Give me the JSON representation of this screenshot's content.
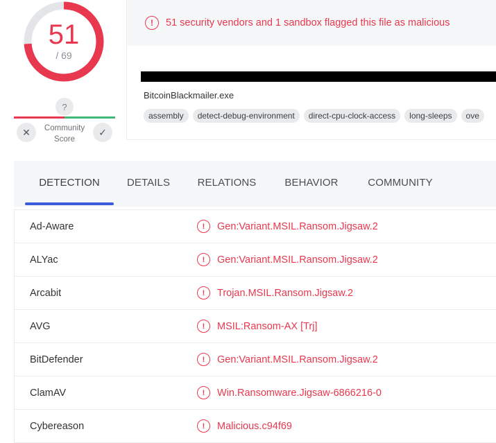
{
  "score": {
    "detected": "51",
    "total": "/ 69",
    "detected_value": 51,
    "total_value": 69,
    "ring_color": "#e8384f"
  },
  "community": {
    "question_mark": "?",
    "label_line1": "Community",
    "label_line2": "Score",
    "down_glyph": "✕",
    "up_glyph": "✓"
  },
  "alert": {
    "icon_glyph": "!",
    "text": "51 security vendors and 1 sandbox flagged this file as malicious"
  },
  "file": {
    "name": "BitcoinBlackmailer.exe",
    "tags": [
      "assembly",
      "detect-debug-environment",
      "direct-cpu-clock-access",
      "long-sleeps",
      "ove"
    ]
  },
  "tabs": [
    {
      "label": "DETECTION"
    },
    {
      "label": "DETAILS"
    },
    {
      "label": "RELATIONS"
    },
    {
      "label": "BEHAVIOR"
    },
    {
      "label": "COMMUNITY"
    }
  ],
  "detections": [
    {
      "engine": "Ad-Aware",
      "result": "Gen:Variant.MSIL.Ransom.Jigsaw.2"
    },
    {
      "engine": "ALYac",
      "result": "Gen:Variant.MSIL.Ransom.Jigsaw.2"
    },
    {
      "engine": "Arcabit",
      "result": "Trojan.MSIL.Ransom.Jigsaw.2"
    },
    {
      "engine": "AVG",
      "result": "MSIL:Ransom-AX [Trj]"
    },
    {
      "engine": "BitDefender",
      "result": "Gen:Variant.MSIL.Ransom.Jigsaw.2"
    },
    {
      "engine": "ClamAV",
      "result": "Win.Ransomware.Jigsaw-6866216-0"
    },
    {
      "engine": "Cybereason",
      "result": "Malicious.c94f69"
    }
  ],
  "colors": {
    "malicious": "#e8384f",
    "accent": "#3b5bdb",
    "community_bad": "#e8384f",
    "community_good": "#3fb878"
  }
}
